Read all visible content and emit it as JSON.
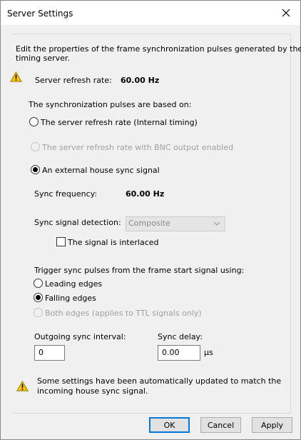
{
  "window": {
    "title": "Server Settings"
  },
  "intro": {
    "line1": "Edit the properties of the frame synchronization pulses generated by the",
    "line2": "timing server."
  },
  "refresh": {
    "label": "Server refresh rate:",
    "value": "60.00 Hz"
  },
  "sync_basis": {
    "heading": "The synchronization pulses are based on:",
    "options": [
      {
        "label": "The server refresh rate (Internal timing)",
        "checked": false,
        "enabled": true
      },
      {
        "label": "The server refresh rate with BNC output enabled",
        "checked": false,
        "enabled": false
      },
      {
        "label": "An external house sync signal",
        "checked": true,
        "enabled": true
      }
    ]
  },
  "sync_freq": {
    "label": "Sync frequency:",
    "value": "60.00 Hz"
  },
  "detection": {
    "label": "Sync signal detection:",
    "selected": "Composite"
  },
  "interlaced": {
    "label": "The signal is interlaced",
    "checked": false
  },
  "trigger": {
    "heading": "Trigger sync pulses from the frame start signal using:",
    "options": [
      {
        "label": "Leading edges",
        "checked": false,
        "enabled": true
      },
      {
        "label": "Falling edges",
        "checked": true,
        "enabled": true
      },
      {
        "label": "Both edges (applies to TTL signals only)",
        "checked": false,
        "enabled": false
      }
    ]
  },
  "outgoing": {
    "label": "Outgoing sync interval:",
    "value": "0"
  },
  "delay": {
    "label": "Sync delay:",
    "value": "0.00",
    "unit": "µs"
  },
  "notice": {
    "line1": "Some settings have been automatically updated to match the",
    "line2": "incoming house sync signal."
  },
  "buttons": {
    "ok": "OK",
    "cancel": "Cancel",
    "apply": "Apply"
  },
  "icons": {
    "warning": "warning-icon",
    "close": "close-icon",
    "dropdown": "chevron-down-icon"
  }
}
